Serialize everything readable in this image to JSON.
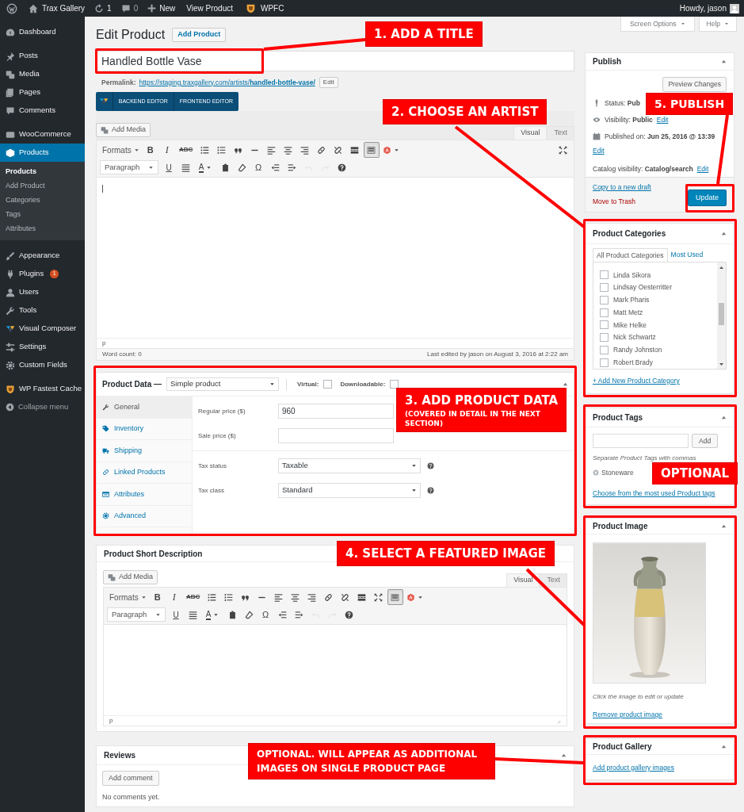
{
  "admin_bar": {
    "site": "Trax Gallery",
    "updates": "1",
    "comments": "0",
    "new": "New",
    "view": "View Product",
    "wpfc": "WPFC",
    "greeting": "Howdy, jason"
  },
  "screen_tabs": [
    "Screen Options",
    "Help"
  ],
  "sidebar": {
    "groups": [
      [
        {
          "label": "Dashboard",
          "selected": false
        }
      ],
      [
        {
          "label": "Posts",
          "selected": false
        },
        {
          "label": "Media",
          "selected": false
        },
        {
          "label": "Pages",
          "selected": false
        },
        {
          "label": "Comments",
          "selected": false
        }
      ],
      [
        {
          "label": "WooCommerce",
          "selected": false
        },
        {
          "label": "Products",
          "selected": true,
          "submenu": [
            {
              "label": "Products",
              "selected": true
            },
            {
              "label": "Add Product",
              "selected": false
            },
            {
              "label": "Categories",
              "selected": false
            },
            {
              "label": "Tags",
              "selected": false
            },
            {
              "label": "Attributes",
              "selected": false
            }
          ]
        },
        {
          "label": "Appearance",
          "selected": false
        },
        {
          "label": "Plugins",
          "selected": false,
          "badge": "1"
        },
        {
          "label": "Users",
          "selected": false
        },
        {
          "label": "Tools",
          "selected": false
        },
        {
          "label": "Visual Composer",
          "selected": false
        },
        {
          "label": "Settings",
          "selected": false
        },
        {
          "label": "Custom Fields",
          "selected": false
        }
      ],
      [
        {
          "label": "WP Fastest Cache",
          "selected": false
        }
      ]
    ],
    "collapse": "Collapse menu"
  },
  "heading": {
    "title": "Edit Product",
    "button": "Add Product"
  },
  "title_field": {
    "value": "Handled Bottle Vase"
  },
  "permalink": {
    "label": "Permalink:",
    "url": "https://staging.traxgallery.com/artists/**handled-bottle-vase/**",
    "button": "Edit"
  },
  "builder_bar": {
    "buttons": [
      "BACKEND EDITOR",
      "FRONTEND EDITOR"
    ]
  },
  "content_editor": {
    "add_media": "Add Media",
    "tabs": [
      {
        "label": "Visual",
        "selected": true
      },
      {
        "label": "Text",
        "selected": false
      }
    ],
    "toolbar": [
      [
        {
          "kind": "dropdown",
          "label": "Formats"
        },
        {
          "kind": "bold",
          "label": "B"
        },
        {
          "kind": "italic",
          "label": "I"
        },
        {
          "kind": "strikethrough",
          "label": "ABC"
        },
        {
          "kind": "icon",
          "pressed": false,
          "disabled": false
        },
        {
          "kind": "icon",
          "pressed": false,
          "disabled": false
        },
        {
          "kind": "icon",
          "pressed": false,
          "disabled": false
        },
        {
          "kind": "icon",
          "pressed": false,
          "disabled": false
        },
        {
          "kind": "icon",
          "pressed": false,
          "disabled": false
        },
        {
          "kind": "icon",
          "pressed": false,
          "disabled": false
        },
        {
          "kind": "icon",
          "pressed": false,
          "disabled": false
        },
        {
          "kind": "icon",
          "pressed": false,
          "disabled": false
        },
        {
          "kind": "icon",
          "pressed": false,
          "disabled": false
        },
        {
          "kind": "icon",
          "pressed": false,
          "disabled": false
        },
        {
          "kind": "icon",
          "pressed": true,
          "disabled": false
        },
        {
          "kind": "icon",
          "pressed": false,
          "disabled": false
        },
        {
          "kind": "icon",
          "pressed": false,
          "disabled": false
        }
      ],
      [
        {
          "kind": "select",
          "label": "Paragraph"
        },
        {
          "kind": "underline",
          "label": "U"
        },
        {
          "kind": "icon",
          "pressed": false,
          "disabled": false
        },
        {
          "kind": "text-color",
          "label": "A"
        },
        {
          "kind": "icon",
          "pressed": false,
          "disabled": false
        },
        {
          "kind": "icon",
          "pressed": false,
          "disabled": false
        },
        {
          "kind": "symbol",
          "label": "Ω"
        },
        {
          "kind": "icon",
          "pressed": false,
          "disabled": false
        },
        {
          "kind": "icon",
          "pressed": false,
          "disabled": false
        },
        {
          "kind": "icon",
          "pressed": false,
          "disabled": true
        },
        {
          "kind": "icon",
          "pressed": false,
          "disabled": true
        },
        {
          "kind": "icon",
          "pressed": false,
          "disabled": false
        }
      ]
    ],
    "path": "p",
    "word_count": "Word count: 0",
    "last_edited": "Last edited by jason on August 3, 2016 at 2:22 am"
  },
  "product_data": {
    "title": "Product Data —",
    "type": "Simple product",
    "options": [
      {
        "label": "Virtual:",
        "checked": false
      },
      {
        "label": "Downloadable:",
        "checked": false
      }
    ],
    "tabs": [
      {
        "label": "General",
        "selected": true
      },
      {
        "label": "Inventory",
        "selected": false
      },
      {
        "label": "Shipping",
        "selected": false
      },
      {
        "label": "Linked Products",
        "selected": false
      },
      {
        "label": "Attributes",
        "selected": false
      },
      {
        "label": "Advanced",
        "selected": false
      }
    ],
    "field_groups": [
      [
        {
          "kind": "text",
          "label": "Regular price ($)",
          "value": "960"
        },
        {
          "kind": "text",
          "label": "Sale price ($)"
        }
      ],
      [
        {
          "kind": "select",
          "label": "Tax status",
          "value": "Taxable"
        },
        {
          "kind": "select",
          "label": "Tax class",
          "value": "Standard"
        }
      ]
    ]
  },
  "short_description": {
    "title": "Product Short Description",
    "add_media": "Add Media",
    "tabs": [
      {
        "label": "Visual",
        "selected": true
      },
      {
        "label": "Text",
        "selected": false
      }
    ],
    "toolbar": [
      [
        {
          "kind": "dropdown",
          "label": "Formats"
        },
        {
          "kind": "bold",
          "label": "B"
        },
        {
          "kind": "italic",
          "label": "I"
        },
        {
          "kind": "strikethrough",
          "label": "ABC"
        },
        {
          "kind": "icon",
          "pressed": false,
          "disabled": false
        },
        {
          "kind": "icon",
          "pressed": false,
          "disabled": false
        },
        {
          "kind": "icon",
          "pressed": false,
          "disabled": false
        },
        {
          "kind": "icon",
          "pressed": false,
          "disabled": false
        },
        {
          "kind": "icon",
          "pressed": false,
          "disabled": false
        },
        {
          "kind": "icon",
          "pressed": false,
          "disabled": false
        },
        {
          "kind": "icon",
          "pressed": false,
          "disabled": false
        },
        {
          "kind": "icon",
          "pressed": false,
          "disabled": false
        },
        {
          "kind": "icon",
          "pressed": false,
          "disabled": false
        },
        {
          "kind": "icon",
          "pressed": false,
          "disabled": false
        },
        {
          "kind": "icon",
          "pressed": false,
          "disabled": false
        },
        {
          "kind": "icon",
          "pressed": true,
          "disabled": false
        },
        {
          "kind": "icon",
          "pressed": false,
          "disabled": false
        }
      ],
      [
        {
          "kind": "select",
          "label": "Paragraph"
        },
        {
          "kind": "underline",
          "label": "U"
        },
        {
          "kind": "icon",
          "pressed": false,
          "disabled": false
        },
        {
          "kind": "text-color",
          "label": "A"
        },
        {
          "kind": "icon",
          "pressed": false,
          "disabled": false
        },
        {
          "kind": "icon",
          "pressed": false,
          "disabled": false
        },
        {
          "kind": "symbol",
          "label": "Ω"
        },
        {
          "kind": "icon",
          "pressed": false,
          "disabled": false
        },
        {
          "kind": "icon",
          "pressed": false,
          "disabled": false
        },
        {
          "kind": "icon",
          "pressed": false,
          "disabled": true
        },
        {
          "kind": "icon",
          "pressed": false,
          "disabled": true
        },
        {
          "kind": "icon",
          "pressed": false,
          "disabled": false
        }
      ]
    ],
    "path": "p"
  },
  "reviews": {
    "title": "Reviews",
    "button": "Add comment",
    "empty": "No comments yet."
  },
  "publish": {
    "title": "Publish",
    "preview": "Preview Changes",
    "rows": [
      {
        "text": "Status: **Pub**"
      },
      {
        "text": "Visibility: **Public**",
        "link": "Edit"
      },
      {
        "text": "Published on: **Jun 25, 2016 @ 13:39**",
        "link": "Edit"
      },
      {
        "text": "Catalog visibility: **Catalog/search**",
        "link": "Edit"
      }
    ],
    "copy": "Copy to a new draft",
    "trash": "Move to Trash",
    "update": "Update"
  },
  "categories": {
    "title": "Product Categories",
    "tabs": [
      {
        "label": "All Product Categories",
        "selected": true
      },
      {
        "label": "Most Used",
        "selected": false
      }
    ],
    "items": [
      {
        "label": "Linda Sikora",
        "checked": false
      },
      {
        "label": "Lindsay Oesterritter",
        "checked": false
      },
      {
        "label": "Mark Pharis",
        "checked": false
      },
      {
        "label": "Matt Metz",
        "checked": false
      },
      {
        "label": "Mike Helke",
        "checked": false
      },
      {
        "label": "Nick Schwartz",
        "checked": false
      },
      {
        "label": "Randy Johnston",
        "checked": false
      },
      {
        "label": "Robert Brady",
        "checked": false
      }
    ],
    "add_link": "+ Add New Product Category"
  },
  "tags": {
    "title": "Product Tags",
    "button": "Add",
    "hint": "Separate Product Tags with commas",
    "tags": [
      "Stoneware"
    ],
    "link": "Choose from the most used Product tags"
  },
  "image": {
    "title": "Product Image",
    "hint": "Click the image to edit or update",
    "link": "Remove product image"
  },
  "gallery": {
    "title": "Product Gallery",
    "link": "Add product gallery images"
  },
  "annotations": [
    {
      "text": "1. ADD A TITLE"
    },
    {
      "text": "2. CHOOSE AN ARTIST"
    },
    {
      "text": "3. ADD PRODUCT DATA",
      "subtext": "(COVERED IN DETAIL IN THE NEXT SECTION)"
    },
    {
      "text": "4. SELECT A FEATURED IMAGE"
    },
    {
      "text": "5. PUBLISH"
    },
    {
      "text": "OPTIONAL"
    },
    {
      "text": "OPTIONAL. WILL APPEAR AS ADDITIONAL IMAGES ON SINGLE PRODUCT PAGE"
    }
  ]
}
